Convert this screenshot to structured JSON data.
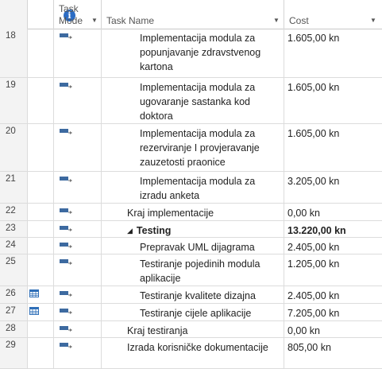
{
  "header": {
    "info_label": "i",
    "mode_label_1": "Task",
    "mode_label_2": "Mode",
    "name_label": "Task Name",
    "cost_label": "Cost"
  },
  "rows": [
    {
      "id": "18",
      "name": "Implementacija modula za popunjavanje zdravstvenog kartona",
      "cost": "1.605,00 kn",
      "level": 2,
      "indicator": "",
      "summary": false
    },
    {
      "id": "19",
      "name": "Implementacija modula za ugovaranje sastanka kod doktora",
      "cost": "1.605,00 kn",
      "level": 2,
      "indicator": "",
      "summary": false
    },
    {
      "id": "20",
      "name": "Implementacija modula za rezerviranje I provjeravanje zauzetosti praonice",
      "cost": "1.605,00 kn",
      "level": 2,
      "indicator": "",
      "summary": false
    },
    {
      "id": "21",
      "name": "Implementacija modula za izradu anketa",
      "cost": "3.205,00 kn",
      "level": 2,
      "indicator": "",
      "summary": false
    },
    {
      "id": "22",
      "name": "Kraj implementacije",
      "cost": "0,00 kn",
      "level": 1,
      "indicator": "",
      "summary": false
    },
    {
      "id": "23",
      "name": "Testing",
      "cost": "13.220,00 kn",
      "level": 1,
      "indicator": "",
      "summary": true
    },
    {
      "id": "24",
      "name": "Prepravak UML dijagrama",
      "cost": "2.405,00 kn",
      "level": 2,
      "indicator": "",
      "summary": false
    },
    {
      "id": "25",
      "name": "Testiranje pojedinih modula aplikacije",
      "cost": "1.205,00 kn",
      "level": 2,
      "indicator": "",
      "summary": false
    },
    {
      "id": "26",
      "name": "Testiranje kvalitete dizajna",
      "cost": "2.405,00 kn",
      "level": 2,
      "indicator": "calendar-icon",
      "summary": false
    },
    {
      "id": "27",
      "name": "Testiranje cijele aplikacije",
      "cost": "7.205,00 kn",
      "level": 2,
      "indicator": "calendar-icon",
      "summary": false
    },
    {
      "id": "28",
      "name": "Kraj testiranja",
      "cost": "0,00 kn",
      "level": 1,
      "indicator": "",
      "summary": false
    },
    {
      "id": "29",
      "name": "Izrada korisničke dokumentacije",
      "cost": "805,00 kn",
      "level": 1,
      "indicator": "",
      "summary": false
    }
  ],
  "colors": {
    "mode_icon": "#3d6aa0",
    "info_icon": "#2b6cc4",
    "calendar_icon": "#2f6fb8"
  }
}
